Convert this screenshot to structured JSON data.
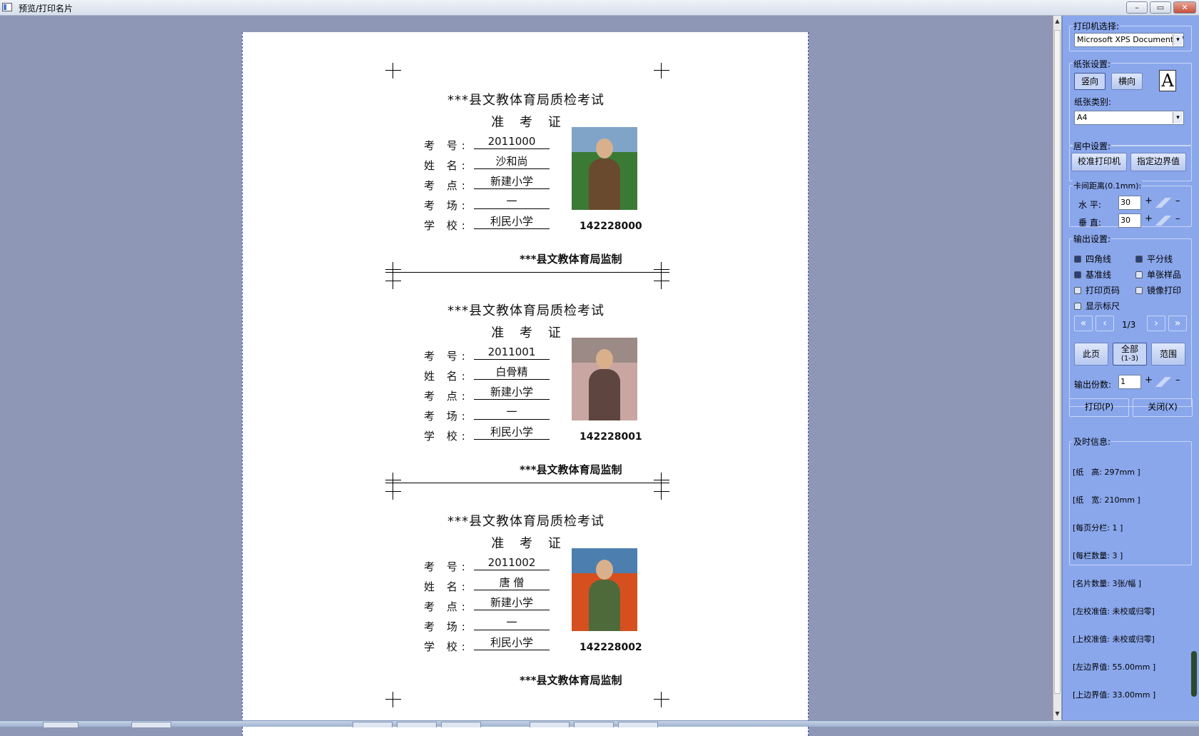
{
  "window": {
    "title": "预览/打印名片",
    "min": "–",
    "restore": "▭",
    "close": "✕"
  },
  "cards": [
    {
      "exam_title": "***县文教体育局质检考试",
      "cert_title": "准 考 证",
      "labels": [
        "考 号:",
        "姓 名:",
        "考 点:",
        "考 场:",
        "学 校:"
      ],
      "values": [
        "2011000",
        "沙和尚",
        "新建小学",
        "一",
        "利民小学"
      ],
      "code": "142228000",
      "supervisor": "***县文教体育局监制",
      "photo_colors": [
        "#7fa4c8",
        "#3b7a35",
        "#6a4a2e"
      ]
    },
    {
      "exam_title": "***县文教体育局质检考试",
      "cert_title": "准 考 证",
      "labels": [
        "考 号:",
        "姓 名:",
        "考 点:",
        "考 场:",
        "学 校:"
      ],
      "values": [
        "2011001",
        "白骨精",
        "新建小学",
        "一",
        "利民小学"
      ],
      "code": "142228001",
      "supervisor": "***县文教体育局监制",
      "photo_colors": [
        "#9c8a86",
        "#c9a6a2",
        "#5e4540"
      ]
    },
    {
      "exam_title": "***县文教体育局质检考试",
      "cert_title": "准 考 证",
      "labels": [
        "考 号:",
        "姓 名:",
        "考 点:",
        "考 场:",
        "学 校:"
      ],
      "values": [
        "2011002",
        "唐 僧",
        "新建小学",
        "一",
        "利民小学"
      ],
      "code": "142228002",
      "supervisor": "***县文教体育局监制",
      "photo_colors": [
        "#4c7fb0",
        "#d6501f",
        "#4f6a3a"
      ]
    }
  ],
  "panel": {
    "printer": {
      "title": "打印机选择:",
      "value": "Microsoft XPS Document Writer"
    },
    "paper": {
      "title": "纸张设置:",
      "portrait": "竖向",
      "landscape": "横向",
      "orientation_icon": "A",
      "type_label": "纸张类别:",
      "type_value": "A4"
    },
    "center": {
      "title": "居中设置:",
      "calibrate": "校准打印机",
      "margin": "指定边界值"
    },
    "gap": {
      "title": "卡间距离(0.1mm):",
      "h_label": "水 平:",
      "h_value": "30",
      "v_label": "垂 直:",
      "v_value": "30",
      "plus": "+",
      "minus": "–"
    },
    "output": {
      "title": "输出设置:",
      "options": [
        {
          "label": "四角线",
          "checked": true
        },
        {
          "label": "平分线",
          "checked": true
        },
        {
          "label": "基准线",
          "checked": true
        },
        {
          "label": "单张样品",
          "checked": false
        },
        {
          "label": "打印页码",
          "checked": false
        },
        {
          "label": "镜像打印",
          "checked": false
        },
        {
          "label": "显示标尺",
          "checked": false
        }
      ],
      "nav": {
        "first": "«",
        "prev": "‹",
        "page": "1/3",
        "next": "›",
        "last": "»"
      },
      "this_page": "此页",
      "all_pages": "全部",
      "all_pages_sub": "(1-3)",
      "range": "范围",
      "copies_label": "输出份数:",
      "copies_value": "1"
    },
    "print_btn": "打印(P)",
    "close_btn": "关闭(X)",
    "info": {
      "title": "及时信息:",
      "lines": [
        "[纸　高: 297mm ]",
        "[纸　宽: 210mm ]",
        "[每页分栏: 1 ]",
        "[每栏数量: 3 ]",
        "[名片数量: 3张/幅 ]",
        "[左校准值: 未校或归零]",
        "[上校准值: 未校或归零]",
        "[左边界值: 55.00mm ]",
        "[上边界值: 33.00mm ]"
      ]
    }
  }
}
